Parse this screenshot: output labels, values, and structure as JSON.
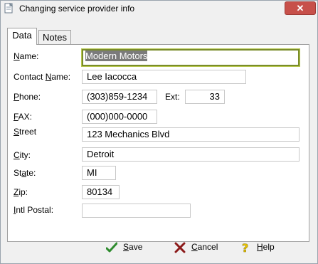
{
  "window": {
    "title": "Changing service provider info",
    "close_glyph": "✕"
  },
  "tabs": [
    {
      "label": "Data",
      "active": true
    },
    {
      "label": "Notes",
      "active": false
    }
  ],
  "form": {
    "name": {
      "label_pre": "",
      "label_u": "N",
      "label_post": "ame:",
      "value": "Modern Motors"
    },
    "contact_name": {
      "label_pre": "Contact ",
      "label_u": "N",
      "label_post": "ame:",
      "value": "Lee Iacocca"
    },
    "phone": {
      "label_pre": "",
      "label_u": "P",
      "label_post": "hone:",
      "value": "(303)859-1234"
    },
    "ext": {
      "label": "Ext:",
      "value": "33"
    },
    "fax": {
      "label_pre": "",
      "label_u": "F",
      "label_post": "AX:",
      "value": "(000)000-0000"
    },
    "street": {
      "label_pre": "",
      "label_u": "S",
      "label_post": "treet",
      "value": "123 Mechanics Blvd"
    },
    "city": {
      "label_pre": "",
      "label_u": "C",
      "label_post": "ity:",
      "value": "Detroit"
    },
    "state": {
      "label_pre": "St",
      "label_u": "a",
      "label_post": "te:",
      "value": "MI"
    },
    "zip": {
      "label_pre": "",
      "label_u": "Z",
      "label_post": "ip:",
      "value": "80134"
    },
    "intl_postal": {
      "label_pre": "",
      "label_u": "I",
      "label_post": "ntl Postal:",
      "value": ""
    }
  },
  "buttons": {
    "save": {
      "u": "S",
      "rest": "ave",
      "icon": "checkmark-icon",
      "color": "#2e8b2e"
    },
    "cancel": {
      "u": "C",
      "rest": "ancel",
      "icon": "x-mark-icon",
      "color": "#8b1a1a"
    },
    "help": {
      "u": "H",
      "rest": "elp",
      "icon": "question-mark-icon",
      "color": "#e6c200"
    }
  },
  "colors": {
    "close_button": "#c7504a",
    "focus_border": "#7a8c2a",
    "selection": "#7b7b7b"
  }
}
